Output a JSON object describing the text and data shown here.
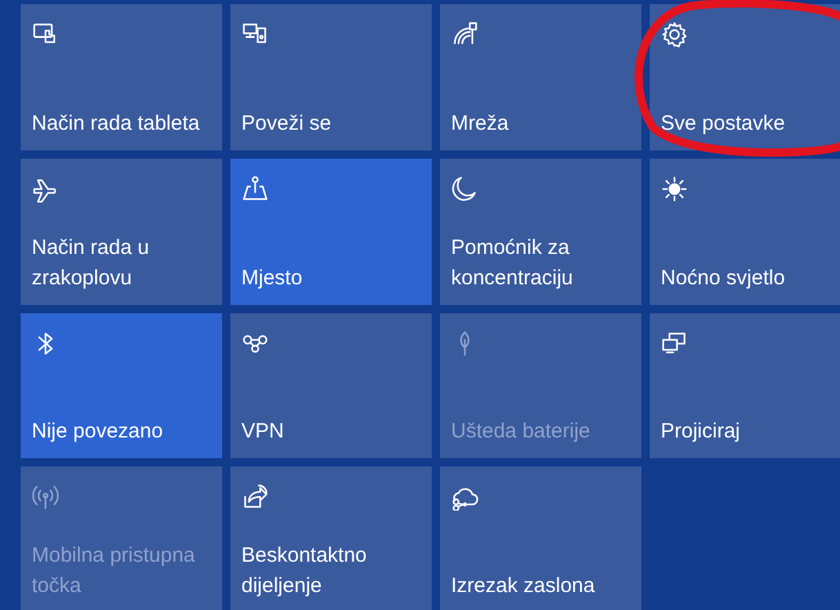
{
  "quick_actions": [
    {
      "label": "Način rada tableta",
      "on": false,
      "disabled": false,
      "circled": false
    },
    {
      "label": "Poveži se",
      "on": false,
      "disabled": false,
      "circled": false
    },
    {
      "label": "Mreža",
      "on": false,
      "disabled": false,
      "circled": false
    },
    {
      "label": "Sve postavke",
      "on": false,
      "disabled": false,
      "circled": true
    },
    {
      "label": "Način rada u zrakoplovu",
      "on": false,
      "disabled": false,
      "circled": false
    },
    {
      "label": "Mjesto",
      "on": true,
      "disabled": false,
      "circled": false
    },
    {
      "label": "Pomoćnik za koncentraciju",
      "on": false,
      "disabled": false,
      "circled": false
    },
    {
      "label": "Noćno svjetlo",
      "on": false,
      "disabled": false,
      "circled": false
    },
    {
      "label": "Nije povezano",
      "on": true,
      "disabled": false,
      "circled": false
    },
    {
      "label": "VPN",
      "on": false,
      "disabled": false,
      "circled": false
    },
    {
      "label": "Ušteda baterije",
      "on": false,
      "disabled": true,
      "circled": false
    },
    {
      "label": "Projiciraj",
      "on": false,
      "disabled": false,
      "circled": false
    },
    {
      "label": "Mobilna pristupna točka",
      "on": false,
      "disabled": true,
      "circled": false
    },
    {
      "label": "Beskontaktno dijeljenje",
      "on": false,
      "disabled": false,
      "circled": false
    },
    {
      "label": "Izrezak zaslona",
      "on": false,
      "disabled": false,
      "circled": false
    }
  ]
}
